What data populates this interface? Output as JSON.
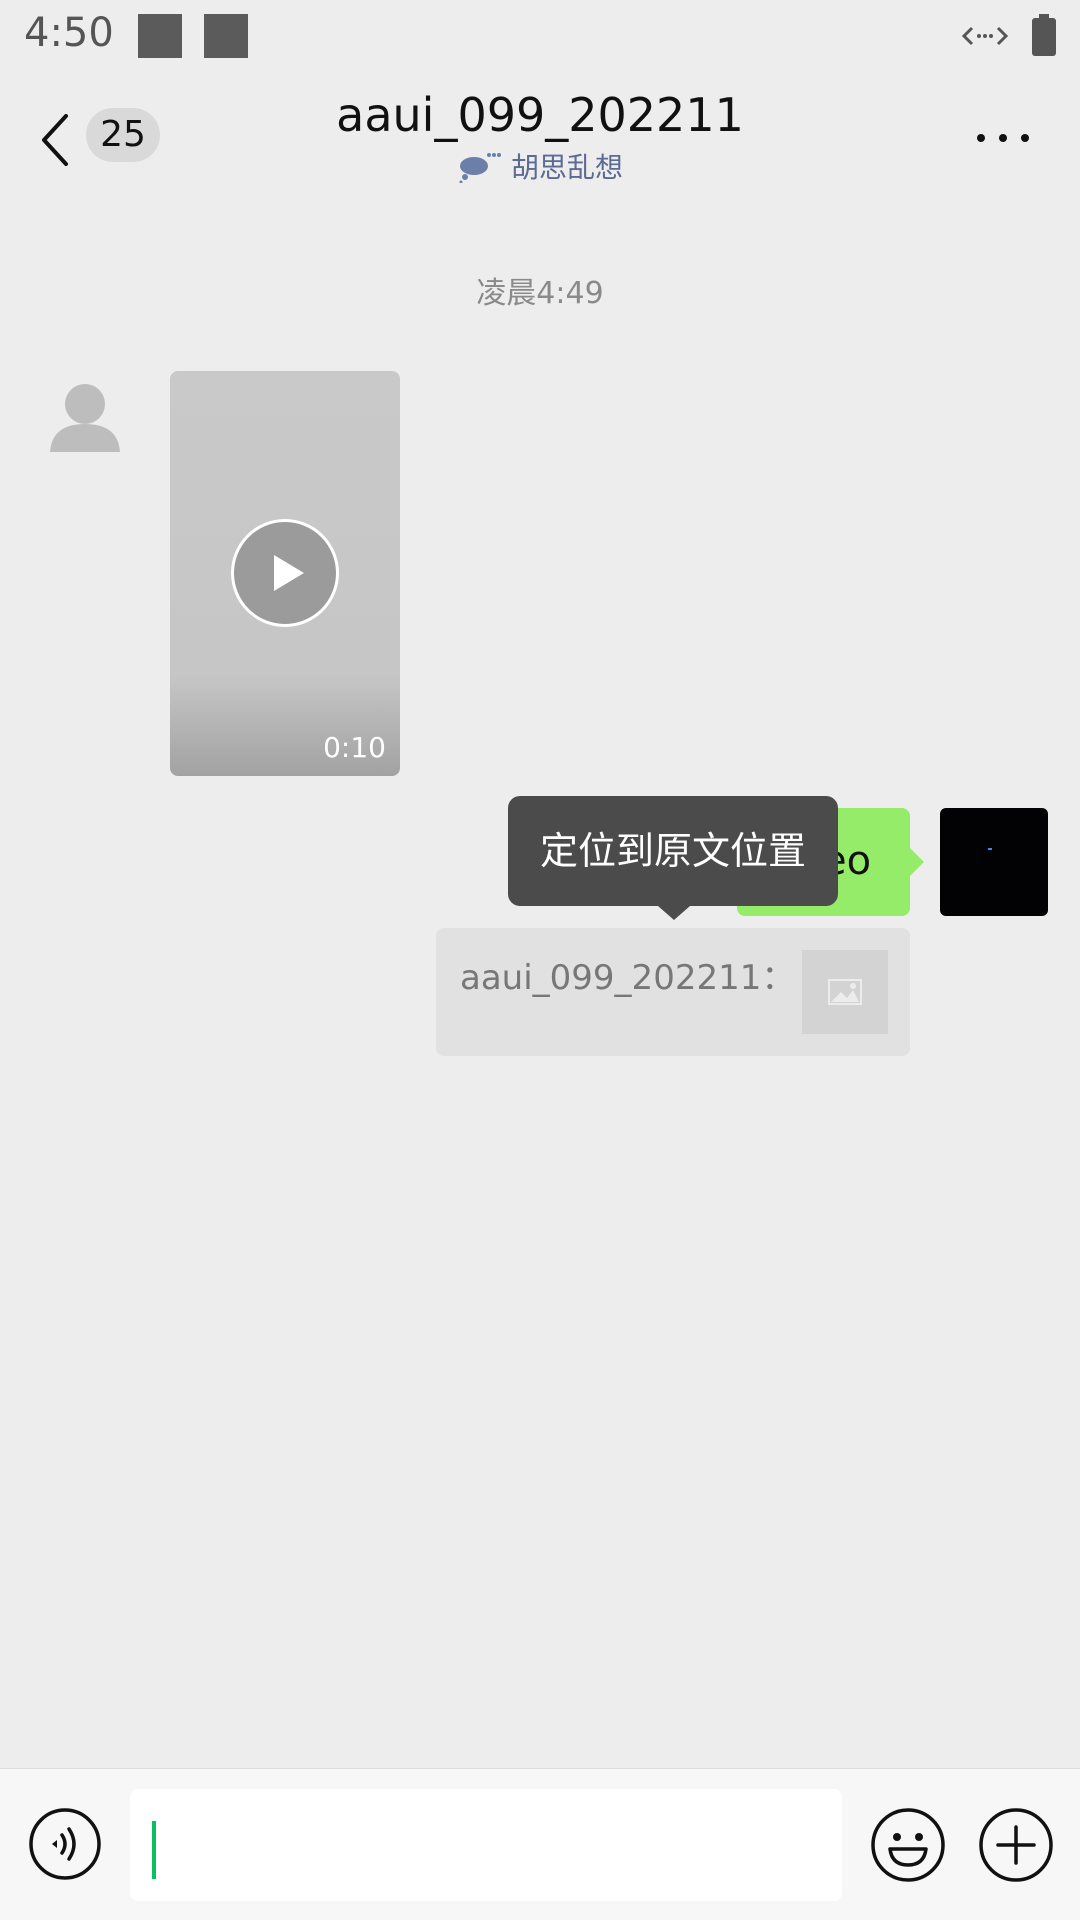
{
  "status_bar": {
    "time": "4:50"
  },
  "header": {
    "unread_count": "25",
    "title": "aaui_099_202211",
    "status": "胡思乱想"
  },
  "chat": {
    "timestamp": "凌晨4:49",
    "incoming_video": {
      "duration": "0:10"
    },
    "outgoing_text_visible": "eo",
    "tooltip": "定位到原文位置",
    "quote": {
      "sender": "aaui_099_202211："
    }
  },
  "icons": {
    "back": "chevron-left-icon",
    "more": "more-dots-icon",
    "play": "play-icon",
    "voice": "voice-icon",
    "emoji": "emoji-icon",
    "plus": "plus-icon",
    "image": "image-icon"
  },
  "colors": {
    "background": "#ededed",
    "sent_bubble": "#95ec69",
    "cursor": "#07c160",
    "tooltip": "#4b4b4b"
  }
}
